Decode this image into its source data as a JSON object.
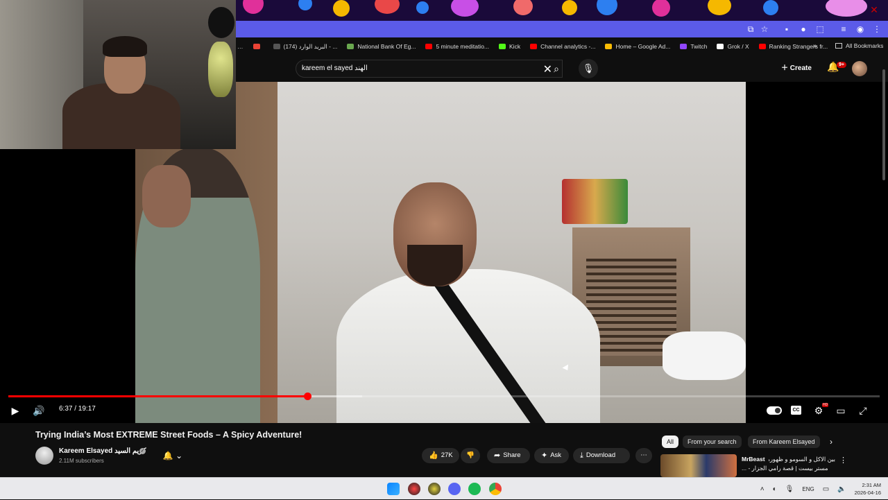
{
  "bookmarks": [
    {
      "label": "…",
      "color": "#888888"
    },
    {
      "label": "",
      "color": "#ea4335",
      "icon": "gmail-icon"
    },
    {
      "label": "(174) البريد الوارد - ...",
      "color": "#555555"
    },
    {
      "label": "National Bank Of Eg...",
      "color": "#6aa84f"
    },
    {
      "label": "5 minute meditatio...",
      "color": "#ff0000"
    },
    {
      "label": "Kick",
      "color": "#53fc18"
    },
    {
      "label": "Channel analytics -...",
      "color": "#ff0000"
    },
    {
      "label": "Home – Google Ad...",
      "color": "#fbbc04"
    },
    {
      "label": "Twitch",
      "color": "#9146ff"
    },
    {
      "label": "Grok / X",
      "color": "#ffffff"
    },
    {
      "label": "Ranking Strangers fr...",
      "color": "#ff0000"
    }
  ],
  "bookmarks_more": "»",
  "all_bookmarks": "All Bookmarks",
  "search": {
    "value": "kareem el sayed الهند"
  },
  "header": {
    "create_label": "Create",
    "notifications_badge": "9+"
  },
  "player": {
    "time": "6:37 / 19:17",
    "played_fraction": 0.343,
    "buffered_fraction": 0.406
  },
  "video": {
    "title": "Trying India’s Most EXTREME Street Foods – A Spicy Adventure!",
    "channel": "Kareem Elsayed كريم السيد",
    "subscribers": "2.11M subscribers"
  },
  "actions": {
    "likes": "27K",
    "share": "Share",
    "ask": "Ask",
    "download": "Download"
  },
  "chips": [
    "All",
    "From your search",
    "From Kareem Elsayed"
  ],
  "recommendation": {
    "channel": "MrBeast",
    "title_line1": "بين الاكل و السومو و ظهوره مع",
    "title_line2": "... - مستر بيست | قصة رامي الجزار"
  },
  "taskbar": {
    "lang": "ENG",
    "time": "2:31 AM",
    "date": "2026-04-16"
  },
  "colors": {
    "accent": "#ff0000",
    "address_bar": "#5b5be8"
  }
}
